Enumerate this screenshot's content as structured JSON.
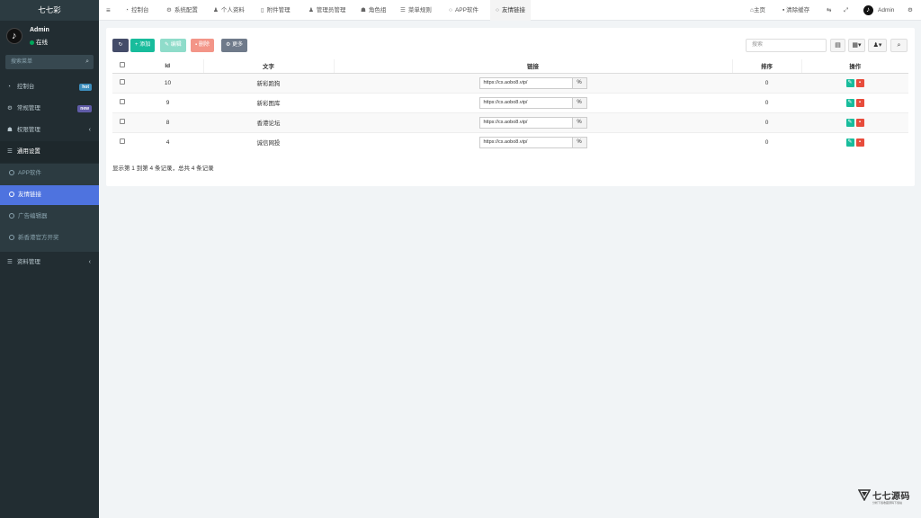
{
  "sidebar": {
    "logo": "七七彩",
    "user": {
      "name": "Admin",
      "status": "在线"
    },
    "search_placeholder": "搜索菜单",
    "menu": [
      {
        "label": "控制台",
        "icon": "dashboard-icon",
        "badge": "hot"
      },
      {
        "label": "常规管理",
        "icon": "cogs-icon",
        "badge": "new"
      },
      {
        "label": "权限管理",
        "icon": "group-icon",
        "chevron": "‹"
      },
      {
        "label": "通用设置",
        "icon": "list-icon"
      }
    ],
    "submenu": [
      {
        "label": "APP软件"
      },
      {
        "label": "友情链接",
        "active": true
      },
      {
        "label": "广告编辑器"
      },
      {
        "label": "新香港官方开奖"
      }
    ],
    "bottom_menu": {
      "label": "资料管理",
      "icon": "list-icon",
      "chevron": "‹"
    }
  },
  "topbar": {
    "tabs": [
      {
        "label": "控制台",
        "icon": "dashboard-icon"
      },
      {
        "label": "系统配置",
        "icon": "gear-icon"
      },
      {
        "label": "个人资料",
        "icon": "user-icon"
      },
      {
        "label": "附件管理",
        "icon": "file-icon"
      },
      {
        "label": "管理员管理",
        "icon": "user-icon"
      },
      {
        "label": "角色组",
        "icon": "group-icon"
      },
      {
        "label": "菜单规则",
        "icon": "bars-icon"
      },
      {
        "label": "APP软件",
        "icon": "circle-icon"
      },
      {
        "label": "友情链接",
        "icon": "circle-icon",
        "active": true
      }
    ],
    "right": {
      "home": "主页",
      "clear_cache": "清除缓存",
      "user": "Admin"
    }
  },
  "toolbar": {
    "add": "添加",
    "edit": "编辑",
    "delete": "删除",
    "more": "更多",
    "search_placeholder": "搜索"
  },
  "table": {
    "headers": {
      "id": "Id",
      "text": "文字",
      "link": "链接",
      "sort": "排序",
      "action": "操作"
    },
    "rows": [
      {
        "id": "10",
        "text": "新彩跑狗",
        "link": "https://cs.aobo8.vip/",
        "sort": "0"
      },
      {
        "id": "9",
        "text": "新彩图库",
        "link": "https://cs.aobo8.vip/",
        "sort": "0"
      },
      {
        "id": "8",
        "text": "香港论坛",
        "link": "https://cs.aobo8.vip/",
        "sort": "0"
      },
      {
        "id": "4",
        "text": "诚信网投",
        "link": "https://cs.aobo8.vip/",
        "sort": "0"
      }
    ],
    "summary": "显示第 1 到第 4 条记录，总共 4 条记录"
  },
  "watermark": {
    "title": "七七源码",
    "subtitle": "分析下载收藏源码下载站"
  },
  "colors": {
    "sidebar": "#222d32",
    "active_menu": "#4e73df",
    "add_button": "#18bc9c",
    "delete_button": "#e74c3c"
  }
}
